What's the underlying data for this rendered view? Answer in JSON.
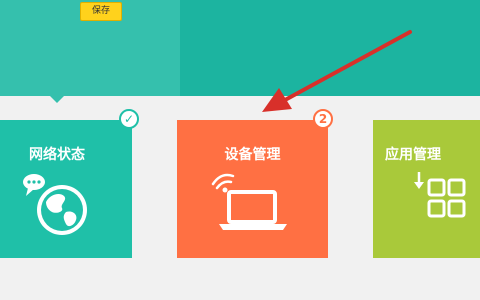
{
  "header": {
    "save_label": "保存"
  },
  "tiles": [
    {
      "label": "网络状态",
      "badge": "✓",
      "icon": "globe-icon",
      "color": "#1fc0a8"
    },
    {
      "label": "设备管理",
      "badge": "2",
      "icon": "laptop-wifi-icon",
      "color": "#ff7043"
    },
    {
      "label": "应用管理",
      "badge": "",
      "icon": "apps-grid-icon",
      "color": "#a9c93a"
    }
  ],
  "colors": {
    "header": "#1cb4a0",
    "header_left": "#35c0ad",
    "annotation_arrow": "#d8302a"
  }
}
